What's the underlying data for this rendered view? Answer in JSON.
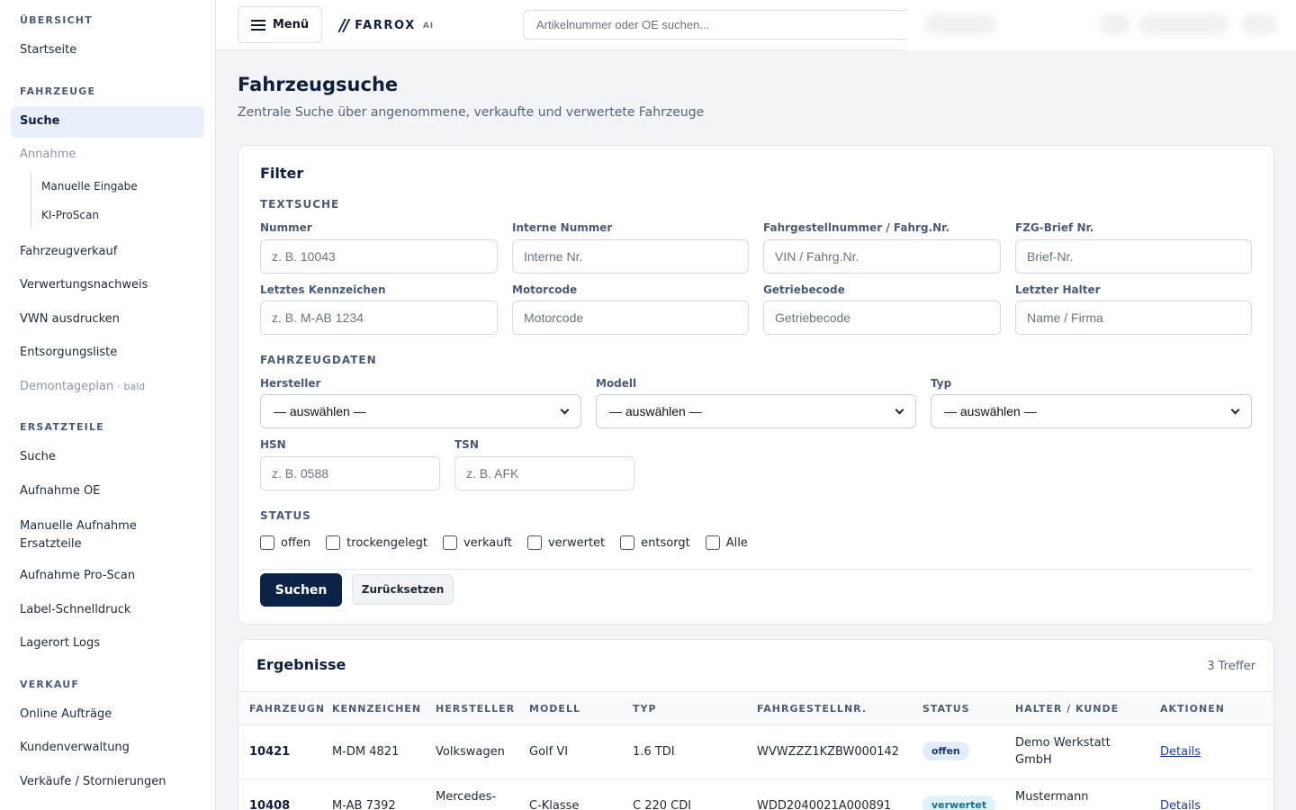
{
  "sidebar": {
    "sections": [
      {
        "title": "ÜBERSICHT"
      },
      {
        "title": "FAHRZEUGE"
      },
      {
        "title": "ERSATZTEILE"
      },
      {
        "title": "VERKAUF"
      }
    ],
    "uebersicht": [
      "Startseite"
    ],
    "fahrzeuge": {
      "suche": "Suche",
      "annahme": "Annahme",
      "annahme_sub": [
        "Manuelle Eingabe",
        "KI-ProScan"
      ],
      "items": [
        "Fahrzeugverkauf",
        "Verwertungsnachweis",
        "VWN ausdrucken",
        "Entsorgungsliste"
      ],
      "demontageplan": "Demontageplan",
      "demontageplan_badge": "· bald"
    },
    "ersatzteile": [
      "Suche",
      "Aufnahme OE",
      "Manuelle Aufnahme Ersatzteile",
      "Aufnahme Pro-Scan",
      "Label-Schnelldruck",
      "Lagerort Logs"
    ],
    "verkauf": [
      "Online Aufträge",
      "Kundenverwaltung",
      "Verkäufe / Stornierungen"
    ]
  },
  "topbar": {
    "menu_label": "Menü",
    "logo_mark": "//",
    "logo_text": "FARROX",
    "logo_ai": "AI",
    "search_placeholder": "Artikelnummer oder OE suchen..."
  },
  "page": {
    "title": "Fahrzeugsuche",
    "subtitle": "Zentrale Suche über angenommene, verkaufte und verwertete Fahrzeuge"
  },
  "filter": {
    "title": "Filter",
    "textsuche_title": "TEXTSUCHE",
    "fields": [
      {
        "label": "Nummer",
        "placeholder": "z. B. 10043"
      },
      {
        "label": "Interne Nummer",
        "placeholder": "Interne Nr."
      },
      {
        "label": "Fahrgestellnummer / Fahrg.Nr.",
        "placeholder": "VIN / Fahrg.Nr."
      },
      {
        "label": "FZG-Brief Nr.",
        "placeholder": "Brief-Nr."
      },
      {
        "label": "Letztes Kennzeichen",
        "placeholder": "z. B. M-AB 1234"
      },
      {
        "label": "Motorcode",
        "placeholder": "Motorcode"
      },
      {
        "label": "Getriebecode",
        "placeholder": "Getriebecode"
      },
      {
        "label": "Letzter Halter",
        "placeholder": "Name / Firma"
      }
    ],
    "fahrzeugdaten_title": "FAHRZEUGDATEN",
    "selects": [
      {
        "label": "Hersteller",
        "value": "— auswählen —"
      },
      {
        "label": "Modell",
        "value": "— auswählen —"
      },
      {
        "label": "Typ",
        "value": "— auswählen —"
      }
    ],
    "hsn": {
      "label": "HSN",
      "placeholder": "z. B. 0588"
    },
    "tsn": {
      "label": "TSN",
      "placeholder": "z. B. AFK"
    },
    "status_title": "STATUS",
    "status_options": [
      "offen",
      "trockengelegt",
      "verkauft",
      "verwertet",
      "entsorgt",
      "Alle"
    ],
    "search_button": "Suchen",
    "reset_button": "Zurücksetzen"
  },
  "results": {
    "title": "Ergebnisse",
    "count": "3 Treffer",
    "columns": [
      "FAHRZEUGN",
      "KENNZEICHEN",
      "HERSTELLER",
      "MODELL",
      "TYP",
      "FAHRGESTELLNR.",
      "STATUS",
      "HALTER / KUNDE",
      "AKTIONEN"
    ],
    "rows": [
      {
        "nummer": "10421",
        "kennzeichen": "M-DM 4821",
        "hersteller": "Volkswagen",
        "modell": "Golf VI",
        "typ": "1.6 TDI",
        "fgnr": "WVWZZZ1KZBW000142",
        "status": "offen",
        "halter": "Demo Werkstatt GmbH",
        "aktion": "Details"
      },
      {
        "nummer": "10408",
        "kennzeichen": "M-AB 7392",
        "hersteller": "Mercedes-",
        "modell": "C-Klasse",
        "typ": "C 220 CDI",
        "fgnr": "WDD2040021A000891",
        "status": "verwertet",
        "halter": "Mustermann",
        "aktion": "Details"
      }
    ]
  },
  "colors": {
    "primary": "#0c2348",
    "active_nav_bg": "#e9f0fb",
    "badge_offen_bg": "#e3edf9",
    "badge_verwertet_bg": "#dff2fa",
    "link": "#1d3aa8"
  }
}
